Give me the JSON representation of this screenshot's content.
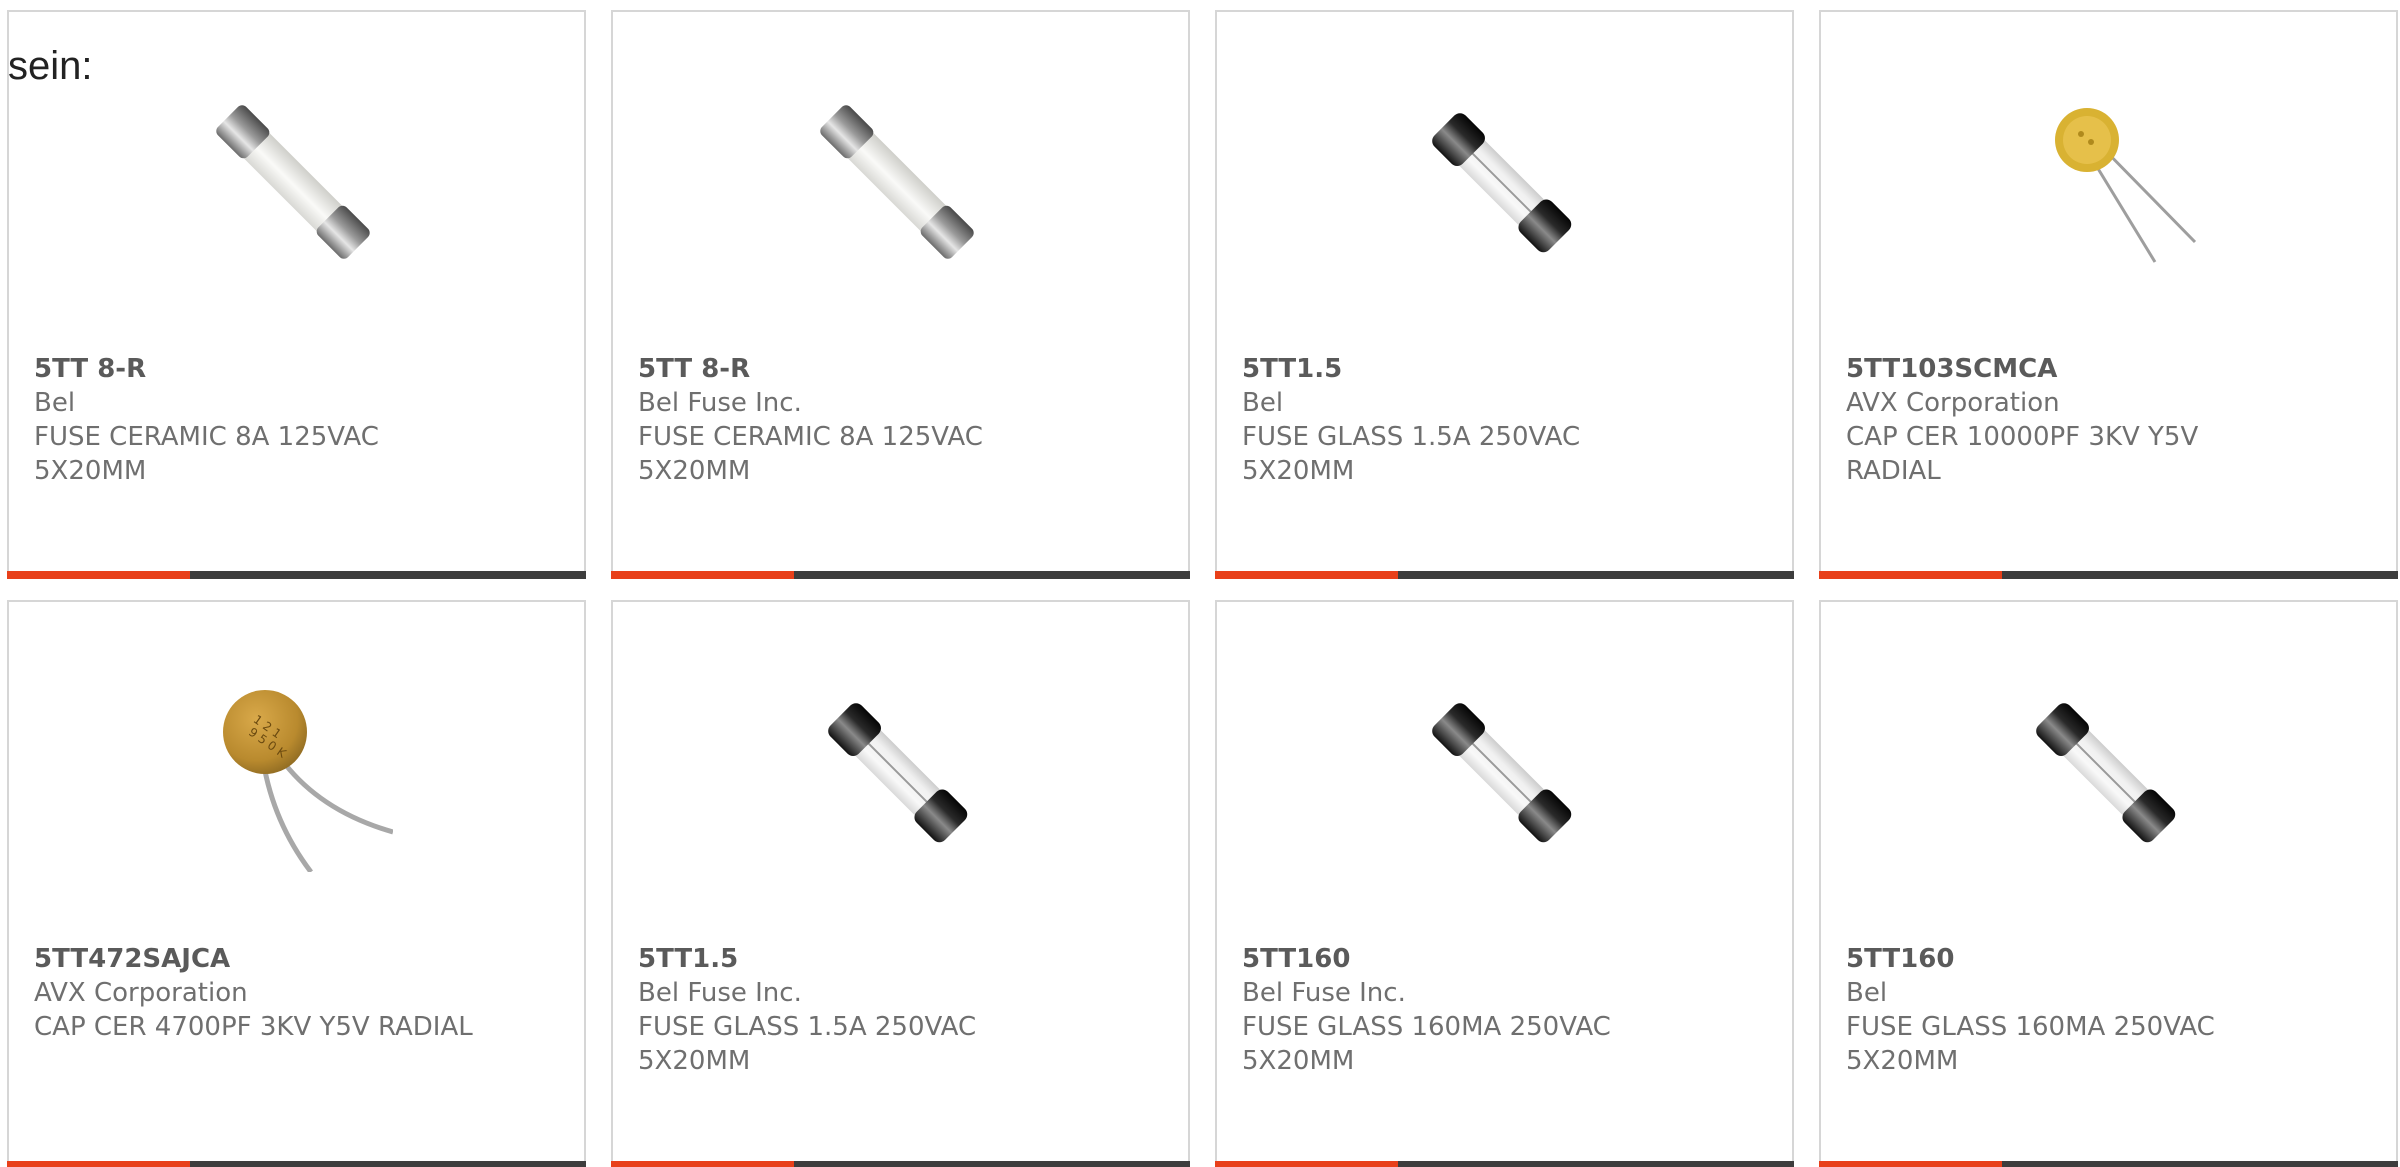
{
  "intro": {
    "text": "sein:"
  },
  "colors": {
    "accent": "#e8401a",
    "bar": "#3d3d3d",
    "card_border": "#d6d6d6",
    "text": "#6f6f6f"
  },
  "products": [
    {
      "part_number": "5TT 8-R",
      "manufacturer": "Bel",
      "description": "FUSE CERAMIC 8A 125VAC 5X20MM",
      "image_icon": "ceramic-fuse-image"
    },
    {
      "part_number": "5TT 8-R",
      "manufacturer": "Bel Fuse Inc.",
      "description": "FUSE CERAMIC 8A 125VAC 5X20MM",
      "image_icon": "ceramic-fuse-image"
    },
    {
      "part_number": "5TT1.5",
      "manufacturer": "Bel",
      "description": "FUSE GLASS 1.5A 250VAC 5X20MM",
      "image_icon": "glass-fuse-image"
    },
    {
      "part_number": "5TT103SCMCA",
      "manufacturer": "AVX Corporation",
      "description": "CAP CER 10000PF 3KV Y5V RADIAL",
      "image_icon": "ceramic-capacitor-image"
    },
    {
      "part_number": "5TT472SAJCA",
      "manufacturer": "AVX Corporation",
      "description": "CAP CER 4700PF 3KV Y5V RADIAL",
      "image_icon": "ceramic-capacitor-image"
    },
    {
      "part_number": "5TT1.5",
      "manufacturer": "Bel Fuse Inc.",
      "description": "FUSE GLASS 1.5A 250VAC 5X20MM",
      "image_icon": "glass-fuse-image"
    },
    {
      "part_number": "5TT160",
      "manufacturer": "Bel Fuse Inc.",
      "description": "FUSE GLASS 160MA 250VAC 5X20MM",
      "image_icon": "glass-fuse-image"
    },
    {
      "part_number": "5TT160",
      "manufacturer": "Bel",
      "description": "FUSE GLASS 160MA 250VAC 5X20MM",
      "image_icon": "glass-fuse-image"
    }
  ]
}
